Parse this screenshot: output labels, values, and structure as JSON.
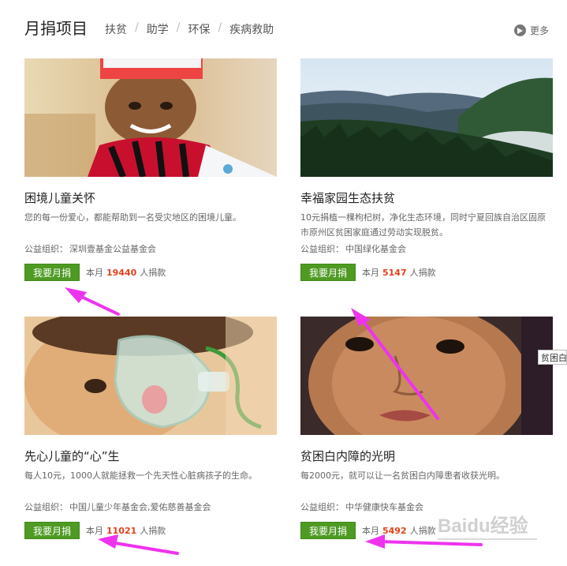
{
  "header": {
    "title": "月捐项目",
    "categories": [
      "扶贫",
      "助学",
      "环保",
      "疾病救助"
    ],
    "separator": "/",
    "more_label": "更多"
  },
  "projects": [
    {
      "title": "困境儿童关怀",
      "description": "您的每一份爱心，都能帮助到一名受灾地区的困境儿童。",
      "org_label": "公益组织：",
      "org": "深圳壹基金公益基金会",
      "button_label": "我要月捐",
      "count_prefix": "本月",
      "count": "19440",
      "count_suffix": "人捐款",
      "image": "smiling-child-red-scarf"
    },
    {
      "title": "幸福家园生态扶贫",
      "description": "10元捐植一棵枸杞树，净化生态环境，同时宁夏回族自治区固原市原州区贫困家庭通过劳动实现脱贫。",
      "org_label": "公益组织：",
      "org": "中国绿化基金会",
      "button_label": "我要月捐",
      "count_prefix": "本月",
      "count": "5147",
      "count_suffix": "人捐款",
      "image": "mountain-forest-landscape"
    },
    {
      "title": "先心儿童的“心”生",
      "description": "每人10元，1000人就能拯救一个先天性心脏病孩子的生命。",
      "org_label": "公益组织：",
      "org": "中国儿童少年基金会,爱佑慈善基金会",
      "button_label": "我要月捐",
      "count_prefix": "本月",
      "count": "11021",
      "count_suffix": "人捐款",
      "image": "baby-oxygen-mask"
    },
    {
      "title": "贫困白内障的光明",
      "description": "每2000元，就可以让一名贫困白内障患者收获光明。",
      "org_label": "公益组织：",
      "org": "中华健康快车基金会",
      "button_label": "我要月捐",
      "count_prefix": "本月",
      "count": "5492",
      "count_suffix": "人捐款",
      "image": "child-face-closeup"
    }
  ],
  "tooltip": "贫困白",
  "watermark": "Baidu经验",
  "colors": {
    "button": "#4e9a23",
    "count_number": "#e2411a",
    "annotation_arrow": "#ee33ee"
  }
}
